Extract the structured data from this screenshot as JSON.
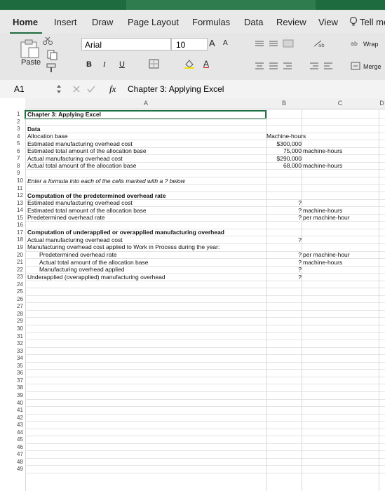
{
  "ribbon": {
    "tabs": [
      "Home",
      "Insert",
      "Draw",
      "Page Layout",
      "Formulas",
      "Data",
      "Review",
      "View",
      "Tell me"
    ],
    "active_tab": "Home",
    "paste_label": "Paste",
    "font_name": "Arial",
    "font_size": "10",
    "wrap_label": "Wrap",
    "merge_label": "Merge",
    "bold_label": "B",
    "italic_label": "I",
    "underline_label": "U",
    "grow_font_label": "A",
    "shrink_font_label": "A",
    "font_color_label": "A"
  },
  "formula_bar": {
    "cell_ref": "A1",
    "fx_label": "fx",
    "content": "Chapter 3: Applying Excel"
  },
  "columns": [
    "A",
    "B",
    "C",
    "D"
  ],
  "rows": [
    {
      "n": "1",
      "a": "Chapter 3: Applying Excel",
      "b": "",
      "c": ""
    },
    {
      "n": "2",
      "a": "",
      "b": "",
      "c": ""
    },
    {
      "n": "3",
      "a": "Data",
      "b": "",
      "c": ""
    },
    {
      "n": "4",
      "a": "Allocation base",
      "b": "Machine-hours",
      "c": ""
    },
    {
      "n": "5",
      "a": "Estimated manufacturing overhead cost",
      "b": "$300,000",
      "c": ""
    },
    {
      "n": "6",
      "a": "Estimated total amount of the allocation base",
      "b": "75,000",
      "c": "machine-hours"
    },
    {
      "n": "7",
      "a": "Actual manufacturing overhead cost",
      "b": "$290,000",
      "c": ""
    },
    {
      "n": "8",
      "a": "Actual total amount of the allocation base",
      "b": "68,000",
      "c": "machine-hours"
    },
    {
      "n": "9",
      "a": "",
      "b": "",
      "c": ""
    },
    {
      "n": "10",
      "a": "Enter a formula into each of the cells marked with a ? below",
      "b": "",
      "c": ""
    },
    {
      "n": "11",
      "a": "",
      "b": "",
      "c": ""
    },
    {
      "n": "12",
      "a": "Computation of the predetermined overhead rate",
      "b": "",
      "c": ""
    },
    {
      "n": "13",
      "a": "Estimated manufacturing overhead cost",
      "b": "?",
      "c": ""
    },
    {
      "n": "14",
      "a": "Estimated total amount of the allocation base",
      "b": "?",
      "c": "machine-hours"
    },
    {
      "n": "15",
      "a": "Predetermined overhead rate",
      "b": "?",
      "c": "per machine-hour"
    },
    {
      "n": "16",
      "a": "",
      "b": "",
      "c": ""
    },
    {
      "n": "17",
      "a": "Computation of underapplied or overapplied manufacturing overhead",
      "b": "",
      "c": ""
    },
    {
      "n": "18",
      "a": "Actual manufacturing overhead cost",
      "b": "?",
      "c": ""
    },
    {
      "n": "19",
      "a": "Manufacturing overhead cost applied to Work in Process during the year:",
      "b": "",
      "c": ""
    },
    {
      "n": "20",
      "a": "Predetermined overhead rate",
      "b": "?",
      "c": "per machine-hour"
    },
    {
      "n": "21",
      "a": "Actual total amount of the allocation base",
      "b": "?",
      "c": "machine-hours"
    },
    {
      "n": "22",
      "a": "Manufacturing overhead applied",
      "b": "?",
      "c": ""
    },
    {
      "n": "23",
      "a": "Underapplied (overapplied) manufacturing overhead",
      "b": "?",
      "c": ""
    },
    {
      "n": "24"
    },
    {
      "n": "25"
    },
    {
      "n": "26"
    },
    {
      "n": "27"
    },
    {
      "n": "28"
    },
    {
      "n": "29"
    },
    {
      "n": "30"
    },
    {
      "n": "31"
    },
    {
      "n": "32"
    },
    {
      "n": "33"
    },
    {
      "n": "34"
    },
    {
      "n": "35"
    },
    {
      "n": "36"
    },
    {
      "n": "37"
    },
    {
      "n": "38"
    },
    {
      "n": "39"
    },
    {
      "n": "40"
    },
    {
      "n": "41"
    },
    {
      "n": "42"
    },
    {
      "n": "43"
    },
    {
      "n": "44"
    },
    {
      "n": "45"
    },
    {
      "n": "46"
    },
    {
      "n": "47"
    },
    {
      "n": "48"
    },
    {
      "n": "49"
    }
  ],
  "colors": {
    "accent": "#217346",
    "ribbon_bg": "#e9e9e9"
  }
}
